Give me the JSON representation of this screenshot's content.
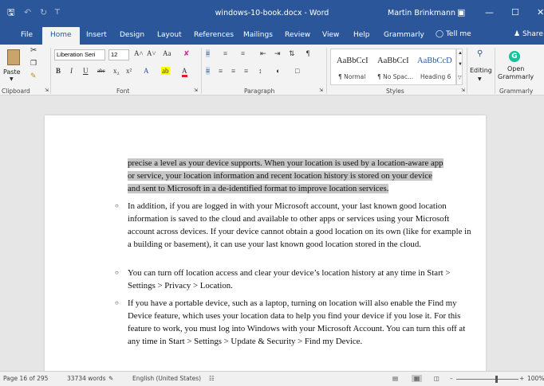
{
  "window": {
    "title": "windows-10-book.docx - Word",
    "user": "Martin Brinkmann",
    "save_icon": "🖫",
    "undo_icon": "↶",
    "redo_icon": "↻",
    "customize_icon": "⊤",
    "ribbon_display_icon": "▣",
    "minimize_icon": "—",
    "maximize_icon": "☐",
    "close_icon": "✕"
  },
  "tabs": [
    {
      "label": "File"
    },
    {
      "label": "Home"
    },
    {
      "label": "Insert"
    },
    {
      "label": "Design"
    },
    {
      "label": "Layout"
    },
    {
      "label": "References"
    },
    {
      "label": "Mailings"
    },
    {
      "label": "Review"
    },
    {
      "label": "View"
    },
    {
      "label": "Help"
    },
    {
      "label": "Grammarly"
    }
  ],
  "tell_me": "Tell me",
  "share_label": "Share",
  "ribbon": {
    "clipboard": {
      "paste_label": "Paste",
      "group_label": "Clipboard"
    },
    "font": {
      "font_name": "Liberation Seri",
      "font_size": "12",
      "grow": "A˄",
      "shrink": "A˅",
      "change_case": "Aa",
      "clear_format": "✘",
      "bold": "B",
      "italic": "I",
      "underline": "U",
      "strike": "abc",
      "subscript": "x₂",
      "superscript": "x²",
      "text_effects": "A",
      "highlight": "ab",
      "font_color": "A",
      "group_label": "Font"
    },
    "paragraph": {
      "group_label": "Paragraph"
    },
    "styles": {
      "items": [
        {
          "sample": "AaBbCcI",
          "name": "¶ Normal"
        },
        {
          "sample": "AaBbCcI",
          "name": "¶ No Spac..."
        },
        {
          "sample": "AaBbCcD",
          "name": "Heading 6"
        }
      ],
      "group_label": "Styles"
    },
    "editing": {
      "label": "Editing"
    },
    "grammarly": {
      "open_line1": "Open",
      "open_line2": "Grammarly",
      "group_label": "Grammarly"
    }
  },
  "document": {
    "selected_lines": [
      "precise a level as your device supports. When your location is used by a location-aware app",
      "or service, your location information and recent location history is stored on your device",
      "and sent to Microsoft in a de-identified format to improve location services."
    ],
    "bullets": [
      "In addition, if you are logged in with your Microsoft account, your last known good location information is saved to the cloud and available to other apps or services using your Microsoft account across devices. If your device cannot obtain a good location on its own (like for example in a building or basement), it can use your last known good location stored in the cloud.",
      "You can turn off location access and clear your device’s location history at any time in Start > Settings > Privacy > Location.",
      "If you have a portable device, such as a laptop, turning on location will also enable the Find my Device feature, which uses your location data to help you find your device if you lose it. For this feature to work, you must log into Windows with your Microsoft Account. You can turn this off at any time in Start > Settings > Update & Security > Find my Device."
    ],
    "bullet_symbol": "○"
  },
  "status": {
    "page": "Page 16 of 295",
    "words": "33734 words",
    "language": "English (United States)",
    "zoom": "100%",
    "zoom_minus": "–",
    "zoom_plus": "+"
  }
}
